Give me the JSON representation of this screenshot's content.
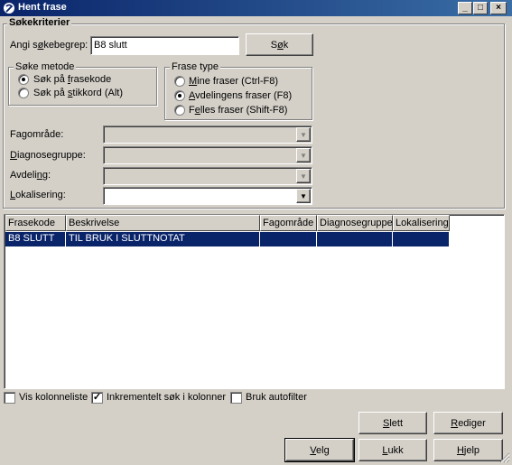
{
  "window": {
    "title": "Hent frase",
    "minimize": "_",
    "maximize": "□",
    "close": "×"
  },
  "criteria": {
    "group_label": "Søkekriterier",
    "search_label": "Angi søkebegrep:",
    "search_value": "B8 slutt",
    "search_button": "Søk"
  },
  "search_method": {
    "label": "Søke metode",
    "options": [
      "Søk på frasekode",
      "Søk på stikkord (Alt)"
    ],
    "selected": 0
  },
  "phrase_type": {
    "label": "Frase type",
    "options": [
      "Mine fraser (Ctrl-F8)",
      "Avdelingens fraser (F8)",
      "Felles fraser (Shift-F8)"
    ],
    "selected": 1
  },
  "filters": {
    "fagomrade": "Fagområde:",
    "diagnosegruppe": "Diagnosegruppe:",
    "avdeling": "Avdeling:",
    "lokalisering": "Lokalisering:"
  },
  "table": {
    "columns": [
      "Frasekode",
      "Beskrivelse",
      "Fagområde",
      "Diagnosegruppe",
      "Lokalisering"
    ],
    "rows": [
      [
        "B8 SLUTT",
        "TIL BRUK I SLUTTNOTAT",
        "",
        "",
        ""
      ]
    ]
  },
  "options": {
    "vis_kolonneliste": "Vis kolonneliste",
    "vis_kolonneliste_checked": false,
    "inkrementelt": "Inkrementelt søk i kolonner",
    "inkrementelt_checked": true,
    "autofilter": "Bruk autofilter",
    "autofilter_checked": false
  },
  "buttons": {
    "slett": "Slett",
    "rediger": "Rediger",
    "velg": "Velg",
    "lukk": "Lukk",
    "hjelp": "Hjelp"
  },
  "colors": {
    "titlebar_start": "#0a246a",
    "titlebar_end": "#3a6ea5",
    "selection": "#0a246a",
    "face": "#d4d0c8"
  }
}
